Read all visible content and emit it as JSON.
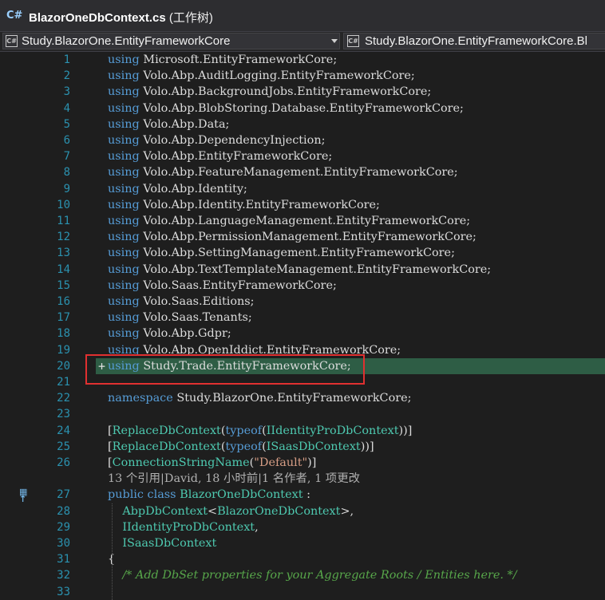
{
  "window": {
    "title": "BlazorOneDbContext.cs",
    "title_suffix": "(工作树)",
    "file_badge": "C#"
  },
  "navbar": {
    "project": "Study.BlazorOne.EntityFrameworkCore",
    "class": "Study.BlazorOne.EntityFrameworkCore.Bl",
    "icon": "C#"
  },
  "code": {
    "using_kw": "using",
    "usings": [
      "Microsoft.EntityFrameworkCore;",
      "Volo.Abp.AuditLogging.EntityFrameworkCore;",
      "Volo.Abp.BackgroundJobs.EntityFrameworkCore;",
      "Volo.Abp.BlobStoring.Database.EntityFrameworkCore;",
      "Volo.Abp.Data;",
      "Volo.Abp.DependencyInjection;",
      "Volo.Abp.EntityFrameworkCore;",
      "Volo.Abp.FeatureManagement.EntityFrameworkCore;",
      "Volo.Abp.Identity;",
      "Volo.Abp.Identity.EntityFrameworkCore;",
      "Volo.Abp.LanguageManagement.EntityFrameworkCore;",
      "Volo.Abp.PermissionManagement.EntityFrameworkCore;",
      "Volo.Abp.SettingManagement.EntityFrameworkCore;",
      "Volo.Abp.TextTemplateManagement.EntityFrameworkCore;",
      "Volo.Saas.EntityFrameworkCore;",
      "Volo.Saas.Editions;",
      "Volo.Saas.Tenants;",
      "Volo.Abp.Gdpr;",
      "Volo.Abp.OpenIddict.EntityFrameworkCore;"
    ],
    "added_marker": "+",
    "added_using": "Study.Trade.EntityFrameworkCore;",
    "namespace_kw": "namespace",
    "namespace_name": "Study.BlazorOne.EntityFrameworkCore;",
    "attr_replace": "ReplaceDbContext",
    "typeof_kw": "typeof",
    "attr1_type": "IIdentityProDbContext",
    "attr2_type": "ISaasDbContext",
    "attr_conn": "ConnectionStringName",
    "conn_value": "\"Default\"",
    "codelens": "13 个引用|David, 18 小时前|1 名作者, 1 项更改",
    "public_kw": "public",
    "class_kw": "class",
    "class_name": "BlazorOneDbContext",
    "colon": ":",
    "base_name": "AbpDbContext",
    "base_generic": "BlazorOneDbContext",
    "iface1": "IIdentityProDbContext",
    "iface2": "ISaasDbContext",
    "brace_open": "{",
    "comment": "/* Add DbSet properties for your Aggregate Roots / Entities here. */"
  },
  "line_numbers": [
    "1",
    "2",
    "3",
    "4",
    "5",
    "6",
    "7",
    "8",
    "9",
    "10",
    "11",
    "12",
    "13",
    "14",
    "15",
    "16",
    "17",
    "18",
    "19",
    "20",
    "21",
    "22",
    "23",
    "24",
    "25",
    "26",
    "27",
    "28",
    "29",
    "30",
    "31",
    "32",
    "33"
  ]
}
